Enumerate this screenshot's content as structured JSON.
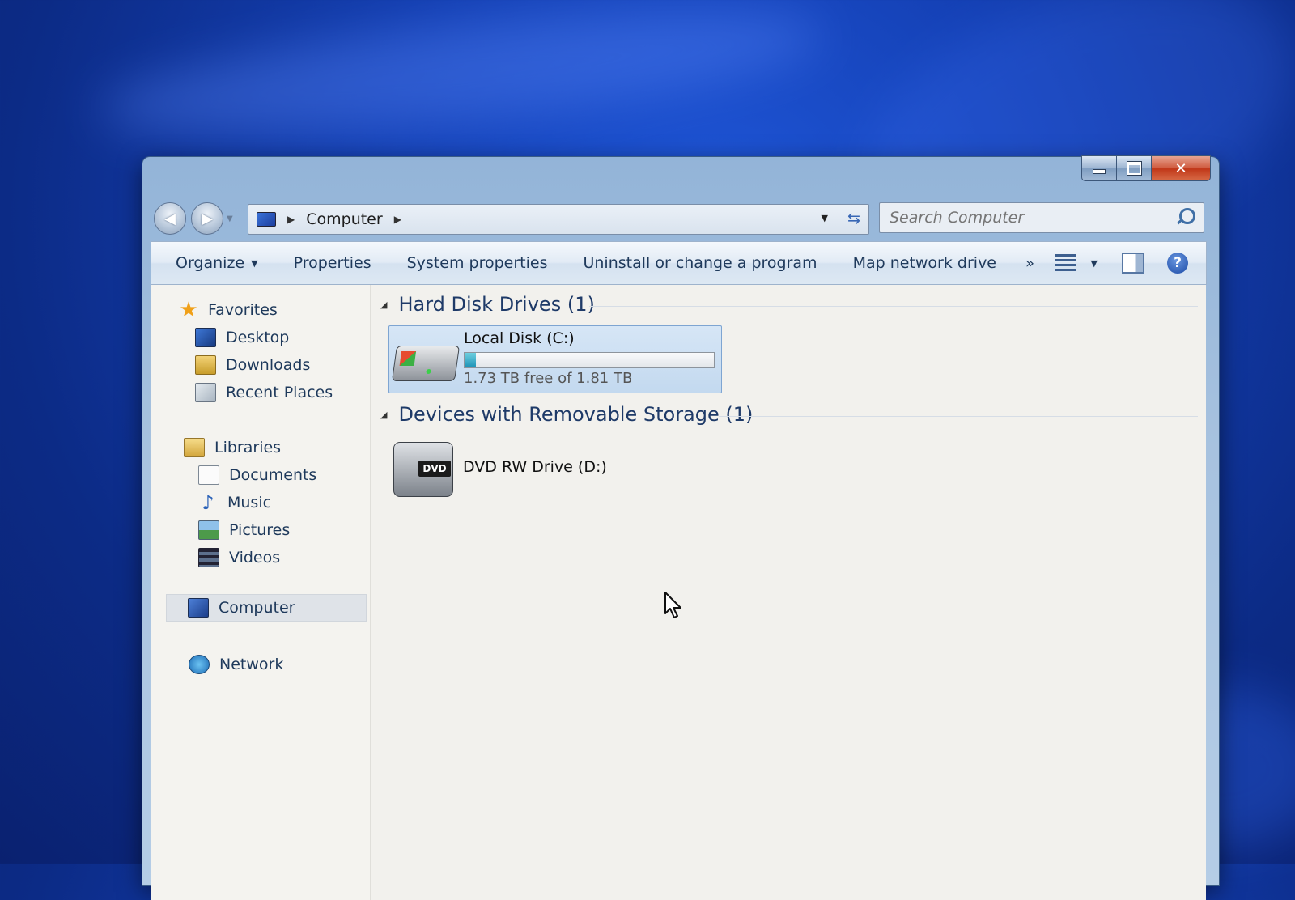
{
  "window": {
    "address_location": "Computer",
    "search_placeholder": "Search Computer"
  },
  "toolbar": {
    "organize": "Organize",
    "properties": "Properties",
    "system_properties": "System properties",
    "uninstall": "Uninstall or change a program",
    "map_drive": "Map network drive",
    "more": "»"
  },
  "sidebar": {
    "favorites": "Favorites",
    "desktop": "Desktop",
    "downloads": "Downloads",
    "recent_places": "Recent Places",
    "libraries": "Libraries",
    "documents": "Documents",
    "music": "Music",
    "pictures": "Pictures",
    "videos": "Videos",
    "computer": "Computer",
    "network": "Network"
  },
  "content": {
    "hard_disk_group": "Hard Disk Drives (1)",
    "removable_group": "Devices with Removable Storage (1)",
    "local_disk": {
      "name": "Local Disk (C:)",
      "free_text": "1.73 TB free of 1.81 TB",
      "used_fraction": 0.044
    },
    "dvd": {
      "name": "DVD RW Drive (D:)",
      "badge": "DVD"
    }
  },
  "icons": {
    "back": "back-arrow-icon",
    "forward": "forward-arrow-icon",
    "refresh": "refresh-icon",
    "search": "search-icon",
    "views": "views-icon",
    "preview_pane": "preview-pane-icon",
    "help": "help-icon"
  },
  "colors": {
    "desktop_blue": "#1440b4",
    "toolbar_text": "#1e395b",
    "selection": "#c3d9ef",
    "close_red": "#c03718"
  }
}
